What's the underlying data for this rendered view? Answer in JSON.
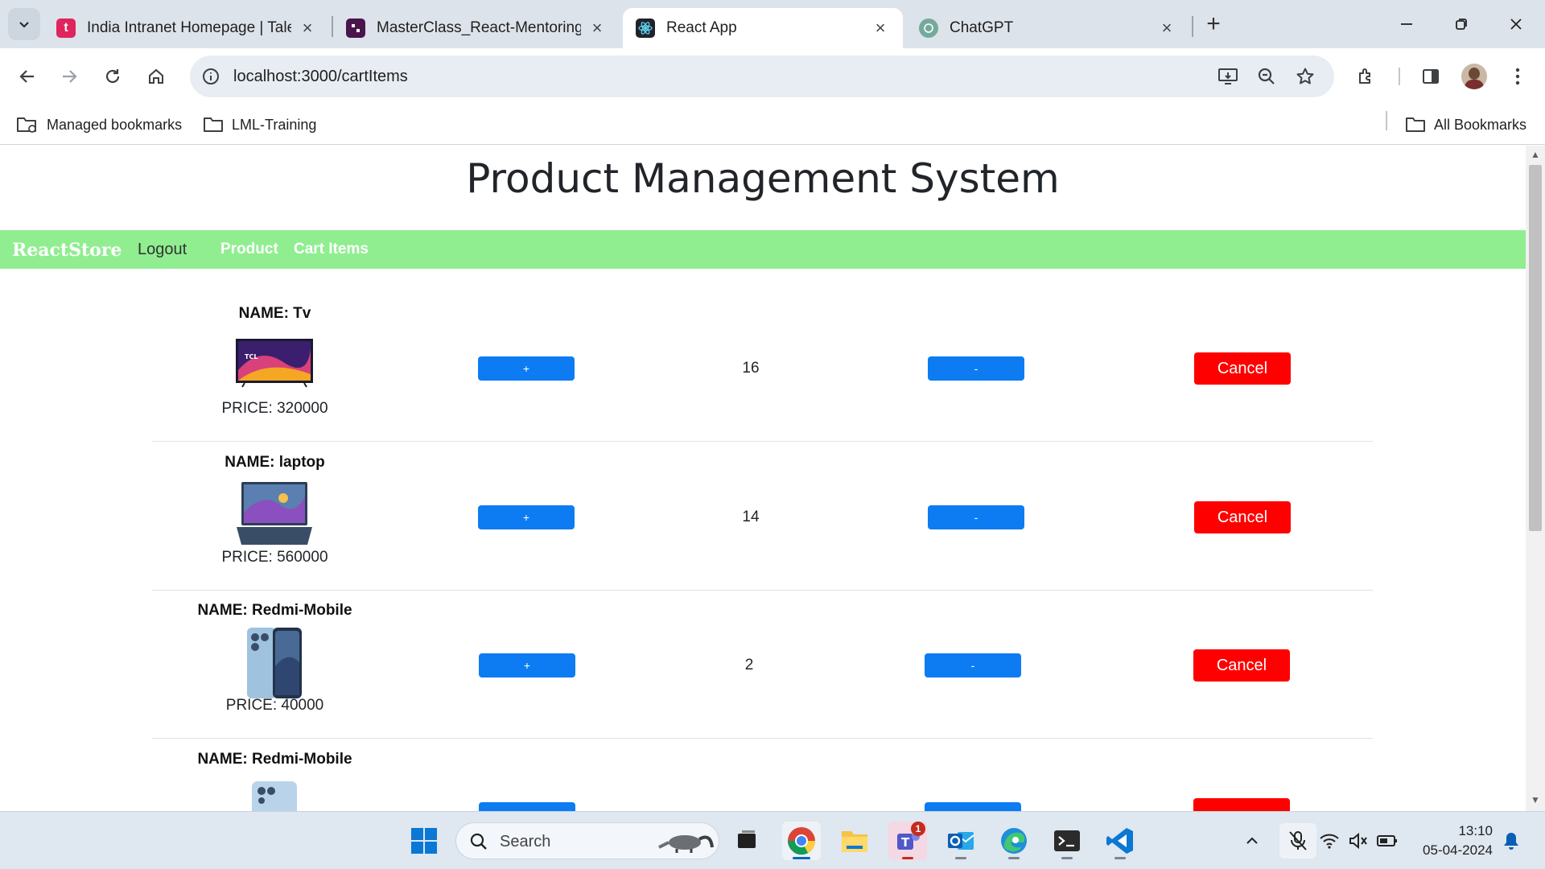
{
  "browser": {
    "tabs": [
      {
        "title": "India Intranet Homepage | Taler",
        "favicon_color": "#e0245e",
        "favicon_letter": "t",
        "active": false
      },
      {
        "title": "MasterClass_React-Mentoring s",
        "favicon_color": "#4a154b",
        "favicon_letter": "",
        "active": false
      },
      {
        "title": "React App",
        "favicon_color": "#20232a",
        "favicon_letter": "",
        "active": true
      },
      {
        "title": "ChatGPT",
        "favicon_color": "#74aa9c",
        "favicon_letter": "",
        "active": false
      }
    ],
    "url": "localhost:3000/cartItems",
    "bookmarks": {
      "managed": "Managed bookmarks",
      "folder1": "LML-Training",
      "all": "All Bookmarks"
    }
  },
  "app": {
    "title": "Product Management System",
    "brand": "ReactStore",
    "nav": {
      "logout": "Logout",
      "product": "Product",
      "cart_items": "Cart Items"
    },
    "colors": {
      "navbar": "#90ee90",
      "qty_button": "#0d7cf2",
      "cancel_button": "#ff0000"
    },
    "cart": [
      {
        "name_label": "NAME: Tv",
        "price_label": "PRICE: 320000",
        "quantity": "16",
        "plus": "+",
        "minus": "-",
        "cancel": "Cancel",
        "image_icon": "tv-image"
      },
      {
        "name_label": "NAME: laptop",
        "price_label": "PRICE: 560000",
        "quantity": "14",
        "plus": "+",
        "minus": "-",
        "cancel": "Cancel",
        "image_icon": "laptop-image"
      },
      {
        "name_label": "NAME: Redmi-Mobile",
        "price_label": "PRICE: 40000",
        "quantity": "2",
        "plus": "+",
        "minus": "-",
        "cancel": "Cancel",
        "image_icon": "phone-image"
      },
      {
        "name_label": "NAME: Redmi-Mobile",
        "price_label": "",
        "quantity": "",
        "plus": "",
        "minus": "",
        "cancel": "",
        "image_icon": "phone-image"
      }
    ]
  },
  "taskbar": {
    "search_placeholder": "Search",
    "teams_badge": "1",
    "time": "13:10",
    "date": "05-04-2024"
  }
}
